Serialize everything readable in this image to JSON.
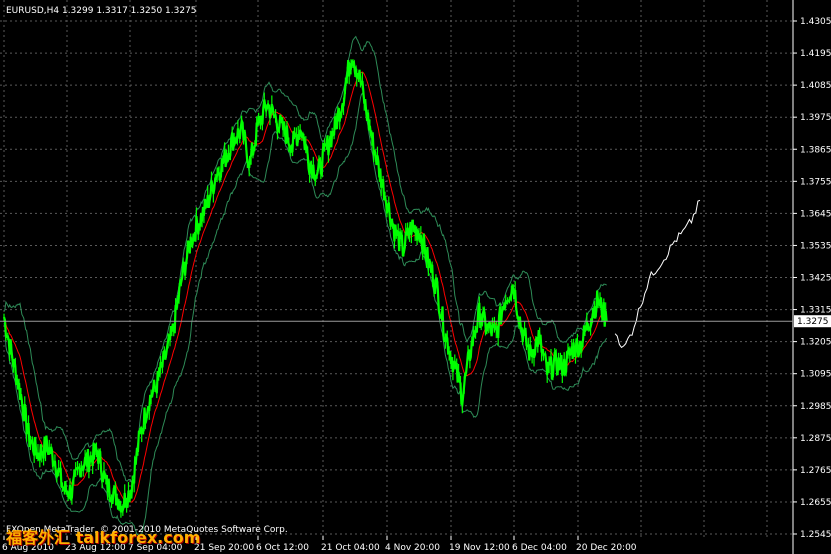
{
  "chart_header": "EURUSD,H4  1.3299 1.3317 1.3250 1.3275",
  "copyright": "FXOpen MetaTrader, © 2001-2010 MetaQuotes Software Corp.",
  "watermark": "福客外汇 talkforex.com",
  "colors": {
    "background": "#000000",
    "grid": "#5a5a5a",
    "candles": "#00ff00",
    "bands": "#2e8b57",
    "ma": "#ff0000",
    "forecast": "#ffffff",
    "text": "#ffffff"
  },
  "chart_data": {
    "type": "line",
    "symbol": "EURUSD",
    "timeframe": "H4",
    "ohlc": {
      "open": 1.3299,
      "high": 1.3317,
      "low": 1.325,
      "close": 1.3275
    },
    "current_price": "1.3275",
    "ylim": [
      1.2545,
      1.4305
    ],
    "y_ticks": [
      "1.4305",
      "1.4195",
      "1.4085",
      "1.3975",
      "1.3865",
      "1.3755",
      "1.3645",
      "1.3535",
      "1.3425",
      "1.3315",
      "1.3205",
      "1.3095",
      "1.2985",
      "1.2875",
      "1.2765",
      "1.2655",
      "1.2545"
    ],
    "x_ticks": [
      "6 Aug 2010",
      "23 Aug 12:00",
      "7 Sep 04:00",
      "21 Sep 20:00",
      "6 Oct 12:00",
      "21 Oct 04:00",
      "4 Nov 20:00",
      "19 Nov 12:00",
      "6 Dec 04:00",
      "20 Dec 20:00"
    ],
    "series": [
      {
        "x": [
          0,
          1,
          2,
          3,
          4,
          5,
          6,
          7,
          8,
          9,
          10,
          11,
          12,
          13,
          14,
          15,
          16,
          17,
          18,
          19,
          20,
          21,
          22,
          23,
          24,
          25,
          26,
          27,
          28,
          29,
          30,
          31,
          32,
          33,
          34,
          35,
          36,
          37,
          38,
          39,
          40,
          41,
          42,
          43,
          44,
          45,
          46,
          47,
          48,
          49,
          50,
          51,
          52,
          53,
          54,
          55,
          56,
          57,
          58,
          59,
          60,
          61,
          62,
          63,
          64,
          65,
          66,
          67,
          68,
          69,
          70,
          71
        ],
        "values": [
          1.329,
          1.315,
          1.302,
          1.287,
          1.282,
          1.285,
          1.28,
          1.27,
          1.269,
          1.278,
          1.28,
          1.283,
          1.272,
          1.268,
          1.265,
          1.27,
          1.288,
          1.3,
          1.306,
          1.315,
          1.325,
          1.343,
          1.355,
          1.362,
          1.368,
          1.378,
          1.383,
          1.39,
          1.393,
          1.382,
          1.395,
          1.402,
          1.397,
          1.393,
          1.388,
          1.394,
          1.382,
          1.378,
          1.387,
          1.394,
          1.405,
          1.42,
          1.41,
          1.395,
          1.382,
          1.37,
          1.359,
          1.352,
          1.36,
          1.358,
          1.348,
          1.339,
          1.323,
          1.313,
          1.302,
          1.318,
          1.33,
          1.325,
          1.323,
          1.335,
          1.34,
          1.325,
          1.316,
          1.322,
          1.31,
          1.313,
          1.312,
          1.318,
          1.32,
          1.328,
          1.335,
          1.3275
        ]
      },
      {
        "x": [
          72,
          73,
          74,
          75,
          76,
          77,
          78,
          79,
          80,
          81,
          82
        ],
        "values": [
          1.324,
          1.318,
          1.324,
          1.333,
          1.342,
          1.346,
          1.35,
          1.355,
          1.358,
          1.362,
          1.369
        ]
      }
    ],
    "grid": true
  }
}
